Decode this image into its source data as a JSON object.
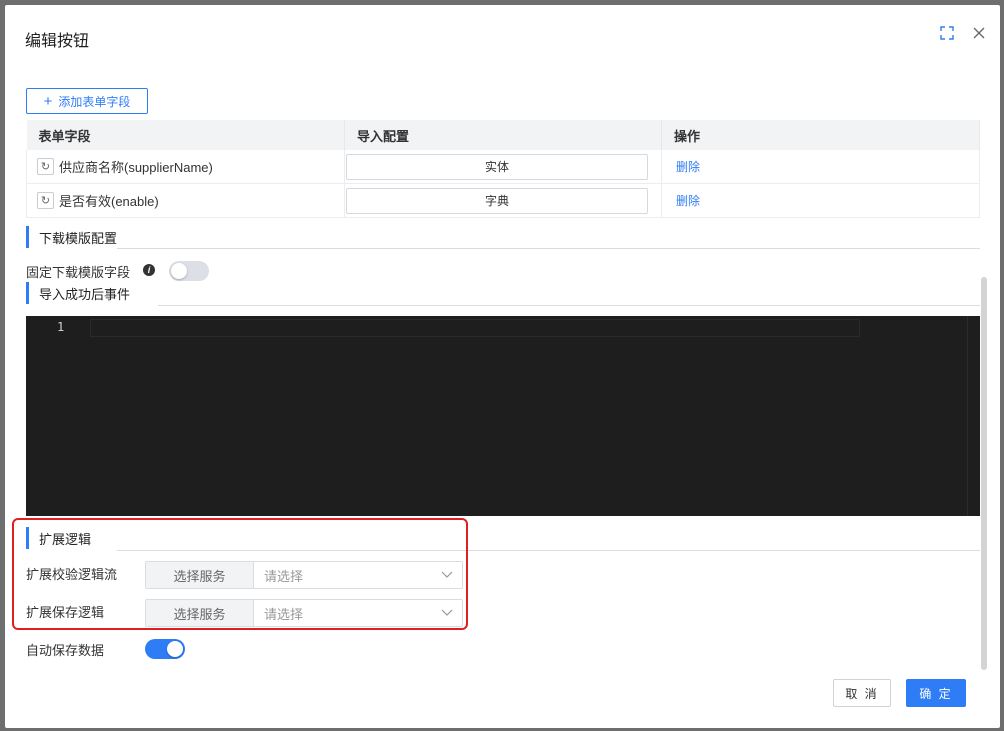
{
  "dialog": {
    "title": "编辑按钮",
    "icons": {
      "fullscreen": "fullscreen-icon",
      "close": "close-icon"
    }
  },
  "fields": {
    "add_button_label": "添加表单字段",
    "columns": [
      "表单字段",
      "导入配置",
      "操作"
    ],
    "rows": [
      {
        "field": "供应商名称(supplierName)",
        "config": "实体",
        "action": "删除"
      },
      {
        "field": "是否有效(enable)",
        "config": "字典",
        "action": "删除"
      }
    ]
  },
  "download_template": {
    "section_title": "下载模版配置",
    "fixed_fields_label": "固定下载模版字段",
    "fixed_fields_enabled": false
  },
  "import_success": {
    "section_title": "导入成功后事件",
    "editor_line_number": "1"
  },
  "extension": {
    "section_title": "扩展逻辑",
    "validation_flow": {
      "label": "扩展校验逻辑流",
      "addon": "选择服务",
      "placeholder": "请选择"
    },
    "save_logic": {
      "label": "扩展保存逻辑",
      "addon": "选择服务",
      "placeholder": "请选择"
    }
  },
  "auto_save": {
    "label": "自动保存数据",
    "enabled": true
  },
  "footer": {
    "cancel_label": "取 消",
    "confirm_label": "确 定"
  },
  "colors": {
    "accent": "#2f7df6",
    "highlight_border": "#e02020",
    "editor_bg": "#1e1e1e"
  }
}
